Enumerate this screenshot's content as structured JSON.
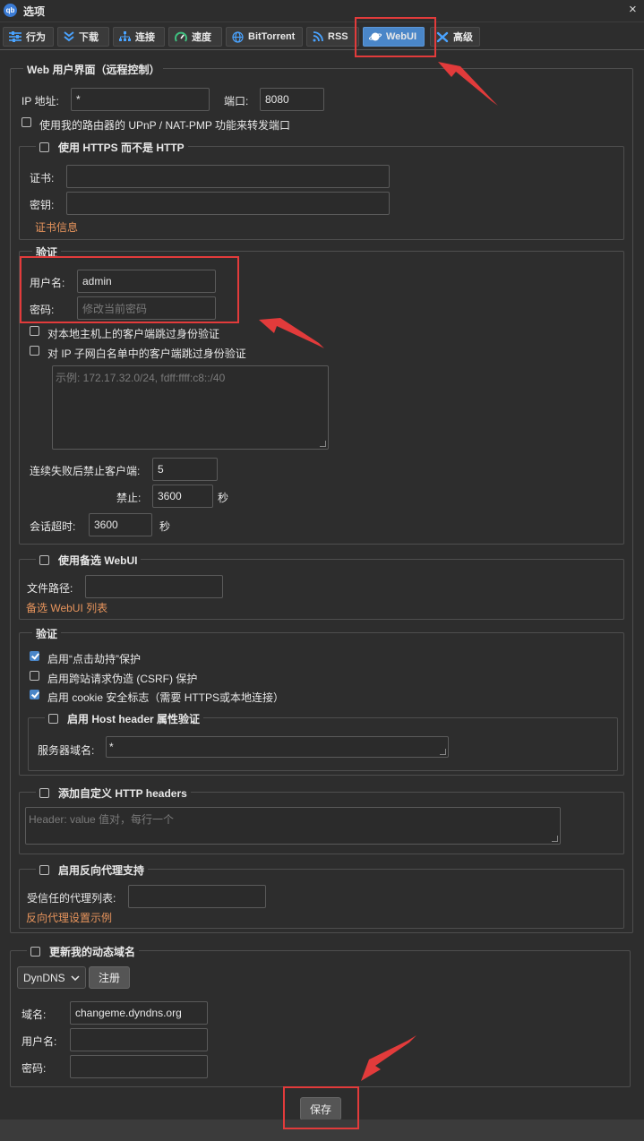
{
  "window": {
    "title": "选项",
    "close": "×",
    "app_icon": "qb"
  },
  "tabs": [
    {
      "label": "行为",
      "icon": "sliders-icon"
    },
    {
      "label": "下载",
      "icon": "download-icon"
    },
    {
      "label": "连接",
      "icon": "network-icon"
    },
    {
      "label": "速度",
      "icon": "speedometer-icon"
    },
    {
      "label": "BitTorrent",
      "icon": "globe-icon"
    },
    {
      "label": "RSS",
      "icon": "rss-icon"
    },
    {
      "label": "WebUI",
      "icon": "webui-icon",
      "active": true
    },
    {
      "label": "高级",
      "icon": "tools-icon"
    }
  ],
  "webui": {
    "legend": "Web 用户界面（远程控制）",
    "ip_label": "IP 地址:",
    "ip_value": "*",
    "port_label": "端口:",
    "port_value": "8080",
    "upnp_label": "使用我的路由器的 UPnP / NAT-PMP 功能来转发端口",
    "https": {
      "legend": "使用 HTTPS 而不是 HTTP",
      "cert_label": "证书:",
      "key_label": "密钥:",
      "cert_info_link": "证书信息"
    },
    "auth": {
      "legend": "验证",
      "username_label": "用户名:",
      "username_value": "admin",
      "password_label": "密码:",
      "password_placeholder": "修改当前密码",
      "bypass_local": "对本地主机上的客户端跳过身份验证",
      "bypass_subnet": "对 IP 子网白名单中的客户端跳过身份验证",
      "subnet_placeholder": "示例: 172.17.32.0/24, fdff:ffff:c8::/40",
      "ban_after_label": "连续失败后禁止客户端:",
      "ban_after_value": "5",
      "ban_label": "禁止:",
      "ban_value": "3600",
      "ban_unit": "秒",
      "session_label": "会话超时:",
      "session_value": "3600",
      "session_unit": "秒"
    },
    "alt_webui": {
      "legend": "使用备选 WebUI",
      "path_label": "文件路径:",
      "list_link": "备选 WebUI 列表"
    },
    "security": {
      "legend": "验证",
      "clickjacking": "启用“点击劫持”保护",
      "csrf": "启用跨站请求伪造 (CSRF) 保护",
      "cookie": "启用 cookie 安全标志（需要 HTTPS或本地连接）",
      "host_header": {
        "legend": "启用 Host header 属性验证",
        "domain_label": "服务器域名:",
        "domain_value": "*"
      }
    },
    "custom_headers": {
      "legend": "添加自定义 HTTP headers",
      "placeholder": "Header: value 值对，每行一个"
    },
    "reverse_proxy": {
      "legend": "启用反向代理支持",
      "trusted_label": "受信任的代理列表:",
      "example_link": "反向代理设置示例"
    }
  },
  "dyndns": {
    "legend": "更新我的动态域名",
    "service_selected": "DynDNS",
    "register_button": "注册",
    "domain_label": "域名:",
    "domain_value": "changeme.dyndns.org",
    "username_label": "用户名:",
    "password_label": "密码:"
  },
  "save_button": "保存",
  "colors": {
    "accent": "#4a86c8",
    "link": "#e7945c",
    "annotation": "#e23b3b",
    "background": "#2d2d2d"
  }
}
